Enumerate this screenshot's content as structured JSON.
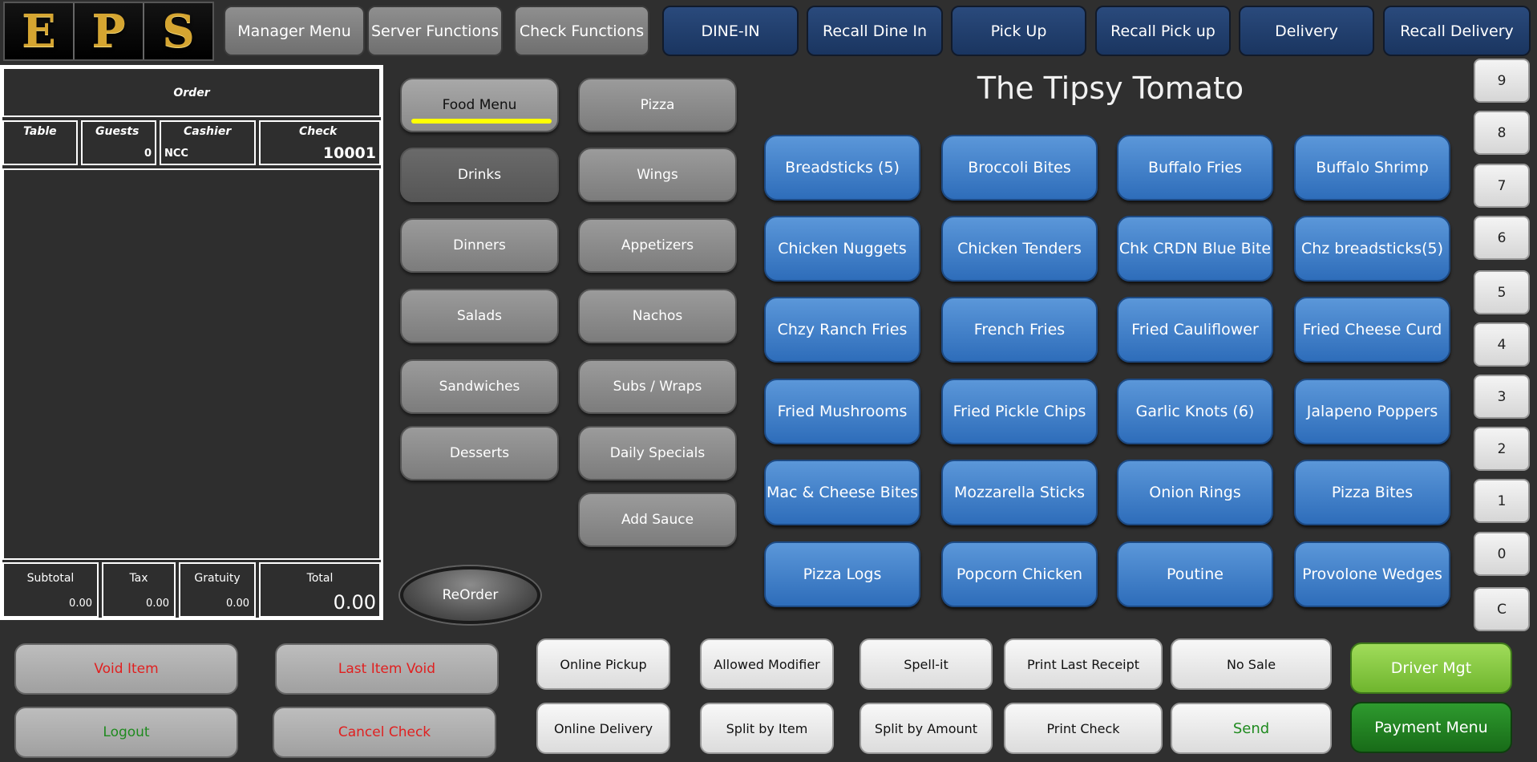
{
  "logo": {
    "letters": [
      "E",
      "P",
      "S"
    ]
  },
  "topnav": {
    "manager_menu": "Manager Menu",
    "server_functions": "Server Functions",
    "check_functions": "Check Functions",
    "dine_in": "DINE-IN",
    "recall_dine_in": "Recall Dine In",
    "pick_up": "Pick Up",
    "recall_pick_up": "Recall Pick up",
    "delivery": "Delivery",
    "recall_delivery": "Recall Delivery"
  },
  "order": {
    "header": "Order",
    "table_label": "Table",
    "guests_label": "Guests",
    "guests_value": "0",
    "cashier_label": "Cashier",
    "cashier_value": "NCC",
    "check_label": "Check",
    "check_value": "10001",
    "subtotal_label": "Subtotal",
    "subtotal_value": "0.00",
    "tax_label": "Tax",
    "tax_value": "0.00",
    "gratuity_label": "Gratuity",
    "gratuity_value": "0.00",
    "total_label": "Total",
    "total_value": "0.00"
  },
  "categories": {
    "col1": [
      "Food Menu",
      "Drinks",
      "Dinners",
      "Salads",
      "Sandwiches",
      "Desserts"
    ],
    "col2": [
      "Pizza",
      "Wings",
      "Appetizers",
      "Nachos",
      "Subs / Wraps",
      "Daily Specials",
      "Add Sauce"
    ],
    "active": "Food Menu"
  },
  "reorder_label": "ReOrder",
  "restaurant_title": "The Tipsy Tomato",
  "menu_items": [
    "Breadsticks (5)",
    "Broccoli Bites",
    "Buffalo Fries",
    "Buffalo Shrimp",
    "Chicken Nuggets",
    "Chicken Tenders",
    "Chk CRDN Blue Bite",
    "Chz breadsticks(5)",
    "Chzy Ranch Fries",
    "French Fries",
    "Fried Cauliflower",
    "Fried Cheese Curd",
    "Fried Mushrooms",
    "Fried Pickle Chips",
    "Garlic Knots (6)",
    "Jalapeno Poppers",
    "Mac & Cheese Bites",
    "Mozzarella Sticks",
    "Onion Rings",
    "Pizza Bites",
    "Pizza Logs",
    "Popcorn Chicken",
    "Poutine",
    "Provolone Wedges"
  ],
  "keypad": [
    "9",
    "8",
    "7",
    "6",
    "5",
    "4",
    "3",
    "2",
    "1",
    "0",
    "C"
  ],
  "bottom": {
    "void_item": "Void Item",
    "last_item_void": "Last Item Void",
    "logout": "Logout",
    "cancel_check": "Cancel Check",
    "online_pickup": "Online Pickup",
    "online_delivery": "Online Delivery",
    "allowed_modifier": "Allowed Modifier",
    "split_by_item": "Split by Item",
    "spell_it": "Spell-it",
    "split_by_amount": "Split by Amount",
    "print_last_receipt": "Print Last Receipt",
    "print_check": "Print Check",
    "no_sale": "No Sale",
    "send": "Send",
    "driver_mgt": "Driver Mgt",
    "payment_menu": "Payment Menu"
  },
  "colors": {
    "red_text": "#e02020",
    "green_text": "#1f8a1f",
    "item_blue": "#3e7fcb",
    "nav_navy": "#1f3d6b",
    "highlight_yellow": "#ffff00",
    "driver_green": "#7dc43a",
    "payment_green": "#1f7a1f"
  }
}
